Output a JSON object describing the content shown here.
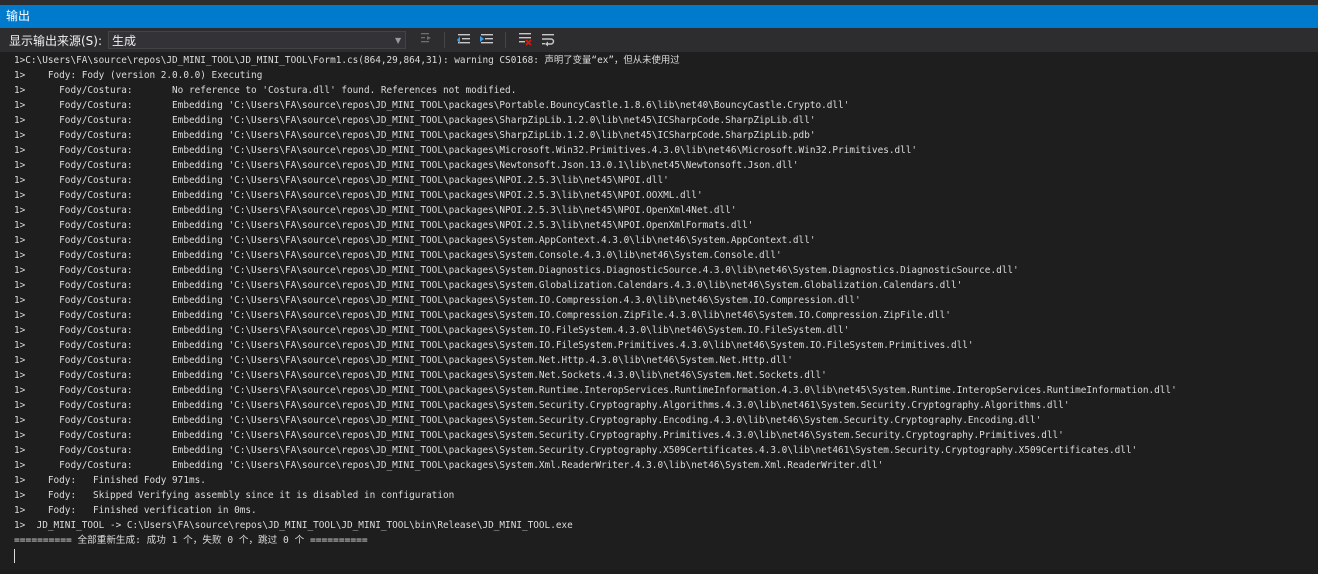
{
  "panel": {
    "title": "输出"
  },
  "toolbar": {
    "source_label": "显示输出来源(S):",
    "source_value": "生成",
    "buttons": [
      {
        "icon": "goto-line-icon"
      },
      {
        "icon": "prev-message-icon"
      },
      {
        "icon": "next-message-icon"
      },
      {
        "icon": "clear-all-icon"
      },
      {
        "icon": "word-wrap-icon"
      }
    ]
  },
  "output_lines": [
    "1>C:\\Users\\FA\\source\\repos\\JD_MINI_TOOL\\JD_MINI_TOOL\\Form1.cs(864,29,864,31): warning CS0168: 声明了变量“ex”，但从未使用过",
    "1>    Fody: Fody (version 2.0.0.0) Executing",
    "1>      Fody/Costura:       No reference to 'Costura.dll' found. References not modified.",
    "1>      Fody/Costura:       Embedding 'C:\\Users\\FA\\source\\repos\\JD_MINI_TOOL\\packages\\Portable.BouncyCastle.1.8.6\\lib\\net40\\BouncyCastle.Crypto.dll'",
    "1>      Fody/Costura:       Embedding 'C:\\Users\\FA\\source\\repos\\JD_MINI_TOOL\\packages\\SharpZipLib.1.2.0\\lib\\net45\\ICSharpCode.SharpZipLib.dll'",
    "1>      Fody/Costura:       Embedding 'C:\\Users\\FA\\source\\repos\\JD_MINI_TOOL\\packages\\SharpZipLib.1.2.0\\lib\\net45\\ICSharpCode.SharpZipLib.pdb'",
    "1>      Fody/Costura:       Embedding 'C:\\Users\\FA\\source\\repos\\JD_MINI_TOOL\\packages\\Microsoft.Win32.Primitives.4.3.0\\lib\\net46\\Microsoft.Win32.Primitives.dll'",
    "1>      Fody/Costura:       Embedding 'C:\\Users\\FA\\source\\repos\\JD_MINI_TOOL\\packages\\Newtonsoft.Json.13.0.1\\lib\\net45\\Newtonsoft.Json.dll'",
    "1>      Fody/Costura:       Embedding 'C:\\Users\\FA\\source\\repos\\JD_MINI_TOOL\\packages\\NPOI.2.5.3\\lib\\net45\\NPOI.dll'",
    "1>      Fody/Costura:       Embedding 'C:\\Users\\FA\\source\\repos\\JD_MINI_TOOL\\packages\\NPOI.2.5.3\\lib\\net45\\NPOI.OOXML.dll'",
    "1>      Fody/Costura:       Embedding 'C:\\Users\\FA\\source\\repos\\JD_MINI_TOOL\\packages\\NPOI.2.5.3\\lib\\net45\\NPOI.OpenXml4Net.dll'",
    "1>      Fody/Costura:       Embedding 'C:\\Users\\FA\\source\\repos\\JD_MINI_TOOL\\packages\\NPOI.2.5.3\\lib\\net45\\NPOI.OpenXmlFormats.dll'",
    "1>      Fody/Costura:       Embedding 'C:\\Users\\FA\\source\\repos\\JD_MINI_TOOL\\packages\\System.AppContext.4.3.0\\lib\\net46\\System.AppContext.dll'",
    "1>      Fody/Costura:       Embedding 'C:\\Users\\FA\\source\\repos\\JD_MINI_TOOL\\packages\\System.Console.4.3.0\\lib\\net46\\System.Console.dll'",
    "1>      Fody/Costura:       Embedding 'C:\\Users\\FA\\source\\repos\\JD_MINI_TOOL\\packages\\System.Diagnostics.DiagnosticSource.4.3.0\\lib\\net46\\System.Diagnostics.DiagnosticSource.dll'",
    "1>      Fody/Costura:       Embedding 'C:\\Users\\FA\\source\\repos\\JD_MINI_TOOL\\packages\\System.Globalization.Calendars.4.3.0\\lib\\net46\\System.Globalization.Calendars.dll'",
    "1>      Fody/Costura:       Embedding 'C:\\Users\\FA\\source\\repos\\JD_MINI_TOOL\\packages\\System.IO.Compression.4.3.0\\lib\\net46\\System.IO.Compression.dll'",
    "1>      Fody/Costura:       Embedding 'C:\\Users\\FA\\source\\repos\\JD_MINI_TOOL\\packages\\System.IO.Compression.ZipFile.4.3.0\\lib\\net46\\System.IO.Compression.ZipFile.dll'",
    "1>      Fody/Costura:       Embedding 'C:\\Users\\FA\\source\\repos\\JD_MINI_TOOL\\packages\\System.IO.FileSystem.4.3.0\\lib\\net46\\System.IO.FileSystem.dll'",
    "1>      Fody/Costura:       Embedding 'C:\\Users\\FA\\source\\repos\\JD_MINI_TOOL\\packages\\System.IO.FileSystem.Primitives.4.3.0\\lib\\net46\\System.IO.FileSystem.Primitives.dll'",
    "1>      Fody/Costura:       Embedding 'C:\\Users\\FA\\source\\repos\\JD_MINI_TOOL\\packages\\System.Net.Http.4.3.0\\lib\\net46\\System.Net.Http.dll'",
    "1>      Fody/Costura:       Embedding 'C:\\Users\\FA\\source\\repos\\JD_MINI_TOOL\\packages\\System.Net.Sockets.4.3.0\\lib\\net46\\System.Net.Sockets.dll'",
    "1>      Fody/Costura:       Embedding 'C:\\Users\\FA\\source\\repos\\JD_MINI_TOOL\\packages\\System.Runtime.InteropServices.RuntimeInformation.4.3.0\\lib\\net45\\System.Runtime.InteropServices.RuntimeInformation.dll'",
    "1>      Fody/Costura:       Embedding 'C:\\Users\\FA\\source\\repos\\JD_MINI_TOOL\\packages\\System.Security.Cryptography.Algorithms.4.3.0\\lib\\net461\\System.Security.Cryptography.Algorithms.dll'",
    "1>      Fody/Costura:       Embedding 'C:\\Users\\FA\\source\\repos\\JD_MINI_TOOL\\packages\\System.Security.Cryptography.Encoding.4.3.0\\lib\\net46\\System.Security.Cryptography.Encoding.dll'",
    "1>      Fody/Costura:       Embedding 'C:\\Users\\FA\\source\\repos\\JD_MINI_TOOL\\packages\\System.Security.Cryptography.Primitives.4.3.0\\lib\\net46\\System.Security.Cryptography.Primitives.dll'",
    "1>      Fody/Costura:       Embedding 'C:\\Users\\FA\\source\\repos\\JD_MINI_TOOL\\packages\\System.Security.Cryptography.X509Certificates.4.3.0\\lib\\net461\\System.Security.Cryptography.X509Certificates.dll'",
    "1>      Fody/Costura:       Embedding 'C:\\Users\\FA\\source\\repos\\JD_MINI_TOOL\\packages\\System.Xml.ReaderWriter.4.3.0\\lib\\net46\\System.Xml.ReaderWriter.dll'",
    "1>    Fody:   Finished Fody 971ms.",
    "1>    Fody:   Skipped Verifying assembly since it is disabled in configuration",
    "1>    Fody:   Finished verification in 0ms.",
    "1>  JD_MINI_TOOL -> C:\\Users\\FA\\source\\repos\\JD_MINI_TOOL\\JD_MINI_TOOL\\bin\\Release\\JD_MINI_TOOL.exe",
    "========== 全部重新生成: 成功 1 个，失败 0 个，跳过 0 个 =========="
  ],
  "colors": {
    "accent": "#007acc",
    "background": "#1e1e1e",
    "toolbar": "#2d2d30",
    "text": "#dcdcdc"
  }
}
